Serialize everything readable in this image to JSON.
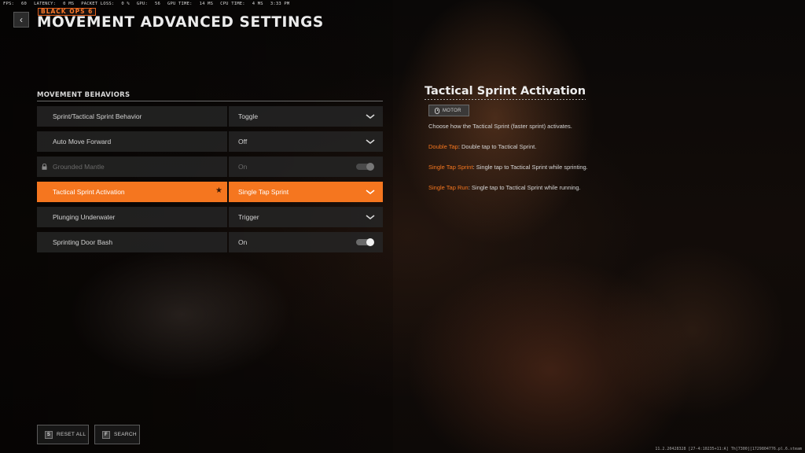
{
  "stats": [
    "FPS:",
    "60",
    "LATENCY:",
    "0 MS",
    "PACKET LOSS:",
    "0 %",
    "GPU:",
    "56",
    "GPU TIME:",
    "14 MS",
    "CPU TIME:",
    "4 MS",
    "3:33 PM"
  ],
  "header": {
    "back_glyph": "‹",
    "logo_text": "BLACK OPS 6",
    "title": "MOVEMENT ADVANCED SETTINGS"
  },
  "section": {
    "title": "MOVEMENT BEHAVIORS",
    "rows": [
      {
        "label": "Sprint/Tactical Sprint Behavior",
        "value": "Toggle",
        "control": "dropdown"
      },
      {
        "label": "Auto Move Forward",
        "value": "Off",
        "control": "dropdown"
      },
      {
        "label": "Grounded Mantle",
        "value": "On",
        "control": "toggle"
      },
      {
        "label": "Tactical Sprint Activation",
        "value": "Single Tap Sprint",
        "control": "dropdown"
      },
      {
        "label": "Plunging Underwater",
        "value": "Trigger",
        "control": "dropdown"
      },
      {
        "label": "Sprinting Door Bash",
        "value": "On",
        "control": "toggle"
      }
    ]
  },
  "detail": {
    "title": "Tactical Sprint Activation",
    "tag": "MOTOR",
    "description": "Choose how the Tactical Sprint (faster sprint) activates.",
    "options": [
      {
        "name": "Double Tap",
        "text": ": Double tap to Tactical Sprint."
      },
      {
        "name": "Single Tap Sprint",
        "text": ": Single tap to Tactical Sprint while sprinting."
      },
      {
        "name": "Single Tap Run",
        "text": ": Single tap to Tactical Sprint while running."
      }
    ]
  },
  "footer": {
    "reset_key": "S",
    "reset_label": "RESET ALL",
    "search_key": "F",
    "search_label": "SEARCH"
  },
  "build": "11.2.20428328 [27-4:10235+11:A] Th[7300][1729804776.pl.6.steam",
  "colors": {
    "accent": "#f5761f",
    "row_bg": "#262626"
  }
}
